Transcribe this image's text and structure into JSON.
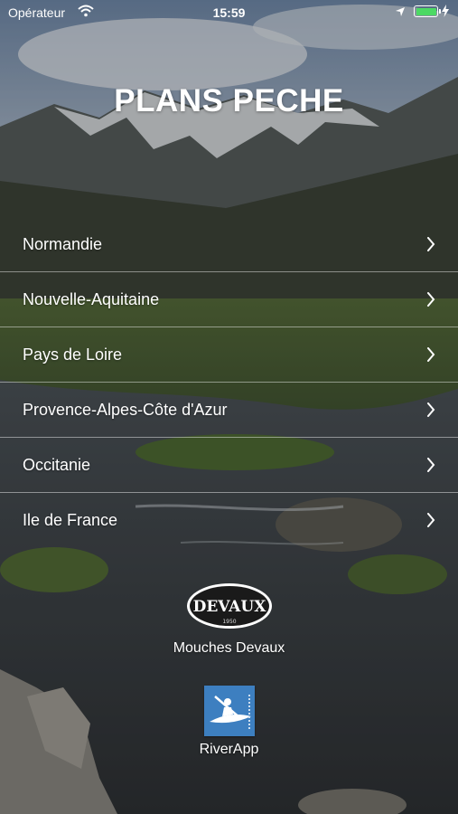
{
  "status_bar": {
    "carrier": "Opérateur",
    "time": "15:59"
  },
  "title": "PLANS PECHE",
  "regions": [
    {
      "label": "Normandie"
    },
    {
      "label": "Nouvelle-Aquitaine"
    },
    {
      "label": "Pays de Loire"
    },
    {
      "label": "Provence-Alpes-Côte d'Azur"
    },
    {
      "label": "Occitanie"
    },
    {
      "label": "Ile de France"
    }
  ],
  "sponsors": {
    "devaux": {
      "label": "Mouches Devaux",
      "logo_text": "DEVAUX",
      "logo_year": "1950"
    },
    "riverapp": {
      "label": "RiverApp"
    }
  },
  "colors": {
    "battery": "#4cd964",
    "riverapp_icon": "#3d7fc0"
  }
}
